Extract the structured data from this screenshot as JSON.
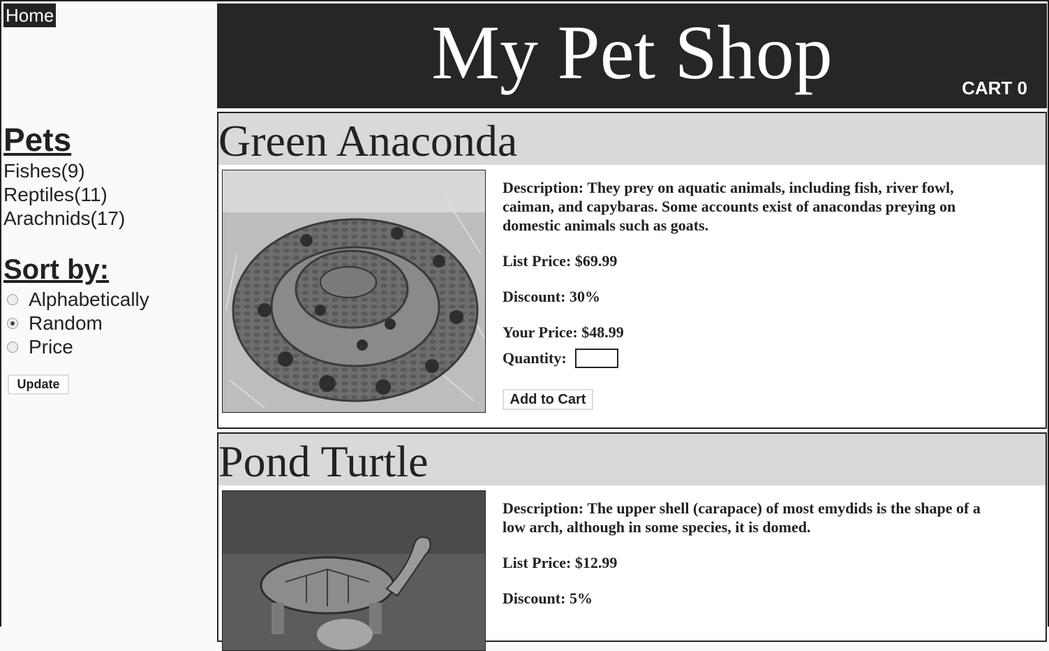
{
  "sidebar": {
    "home_label": "Home",
    "pets_heading": "Pets",
    "categories": [
      {
        "label": "Fishes(9)"
      },
      {
        "label": "Reptiles(11)"
      },
      {
        "label": "Arachnids(17)"
      }
    ],
    "sort_heading": "Sort by:",
    "sort_options": [
      {
        "label": "Alphabetically",
        "checked": false
      },
      {
        "label": "Random",
        "checked": true
      },
      {
        "label": "Price",
        "checked": false
      }
    ],
    "update_label": "Update"
  },
  "header": {
    "title": "My Pet Shop",
    "cart_label": "CART 0"
  },
  "products": [
    {
      "name": "Green Anaconda",
      "description": "Description: They prey on aquatic animals, including fish, river fowl, caiman, and capybaras. Some accounts exist of anacondas preying on domestic animals such as goats.",
      "list_price": "List Price: $69.99",
      "discount": "Discount: 30%",
      "your_price": "Your Price: $48.99",
      "quantity_label": "Quantity:",
      "quantity_value": "",
      "add_label": "Add to Cart"
    },
    {
      "name": "Pond Turtle",
      "description": "Description: The upper shell (carapace) of most emydids is the shape of a low arch, although in some species, it is domed.",
      "list_price": "List Price: $12.99",
      "discount": "Discount: 5%"
    }
  ],
  "colors": {
    "header_bg": "#262626",
    "title_bar_bg": "#d9d9d9",
    "text": "#222222"
  }
}
